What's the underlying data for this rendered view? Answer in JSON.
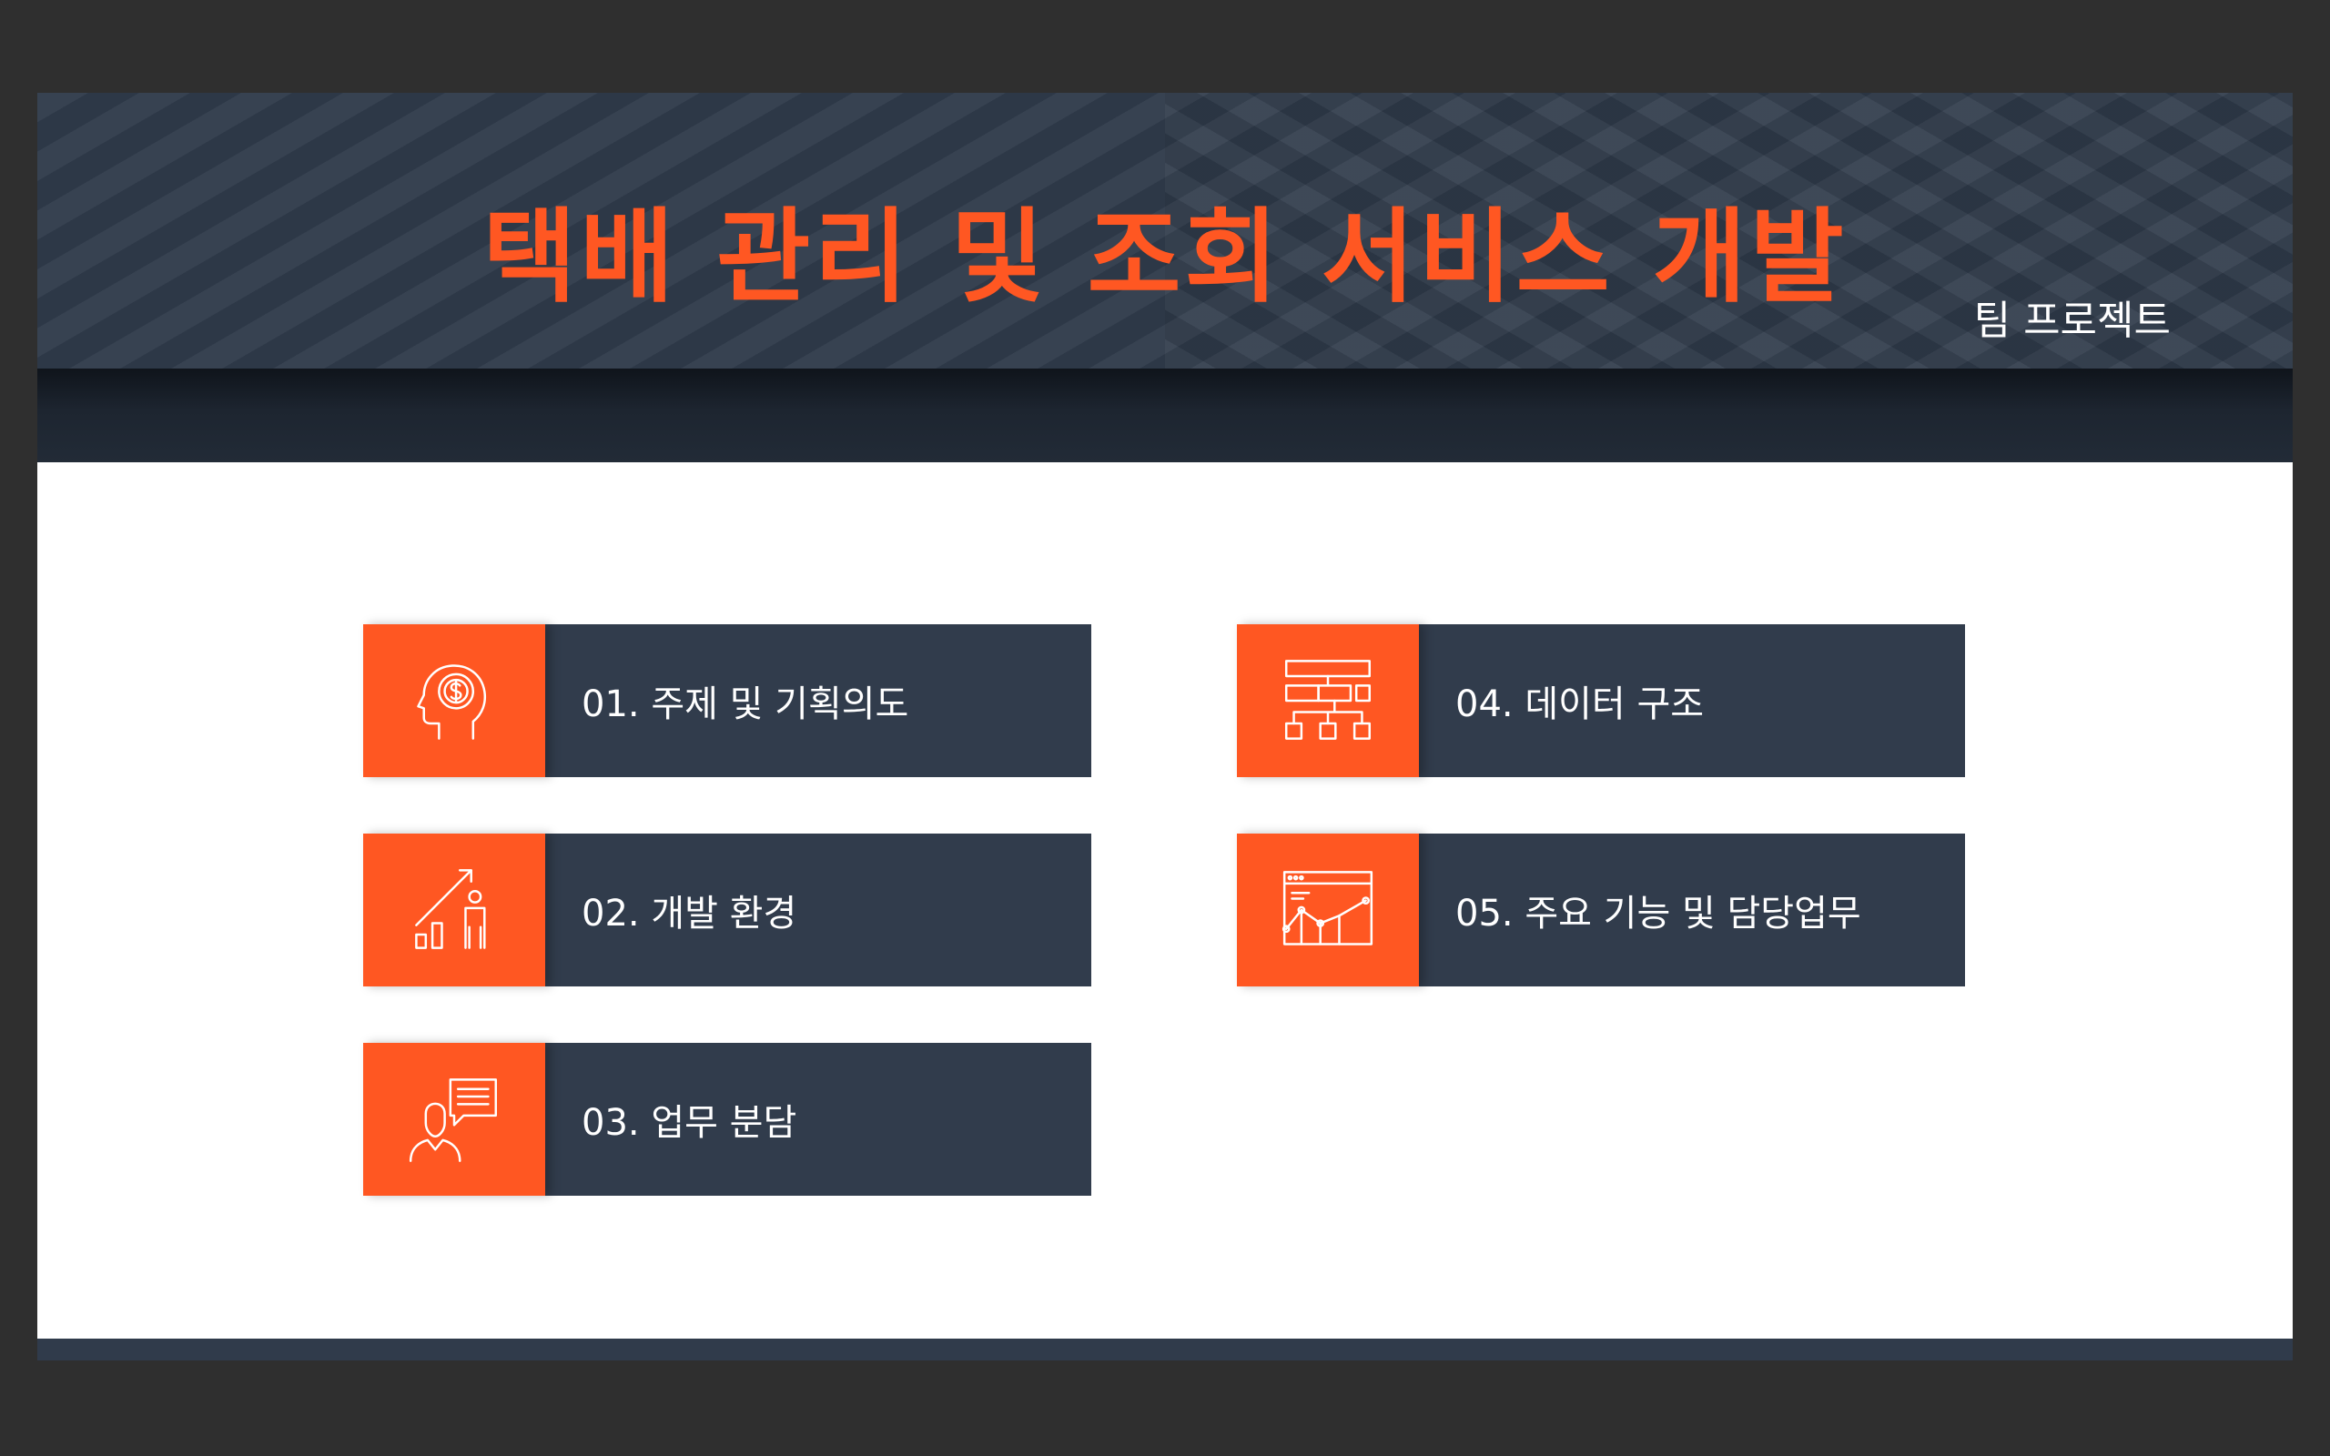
{
  "header": {
    "title": "택배 관리 및 조회 서비스 개발",
    "subtitle": "팀 프로젝트"
  },
  "menu": [
    {
      "label": "01. 주제 및 기획의도",
      "icon": "head-dollar-icon"
    },
    {
      "label": "02. 개발 환경",
      "icon": "growth-chart-person-icon"
    },
    {
      "label": "03. 업무 분담",
      "icon": "person-speech-bubble-icon"
    },
    {
      "label": "04. 데이터 구조",
      "icon": "hierarchy-structure-icon"
    },
    {
      "label": "05. 주요 기능 및 담당업무",
      "icon": "browser-line-chart-icon"
    }
  ],
  "colors": {
    "accent": "#ff5722",
    "navy": "#313c4c",
    "background": "#2f2f2f"
  }
}
